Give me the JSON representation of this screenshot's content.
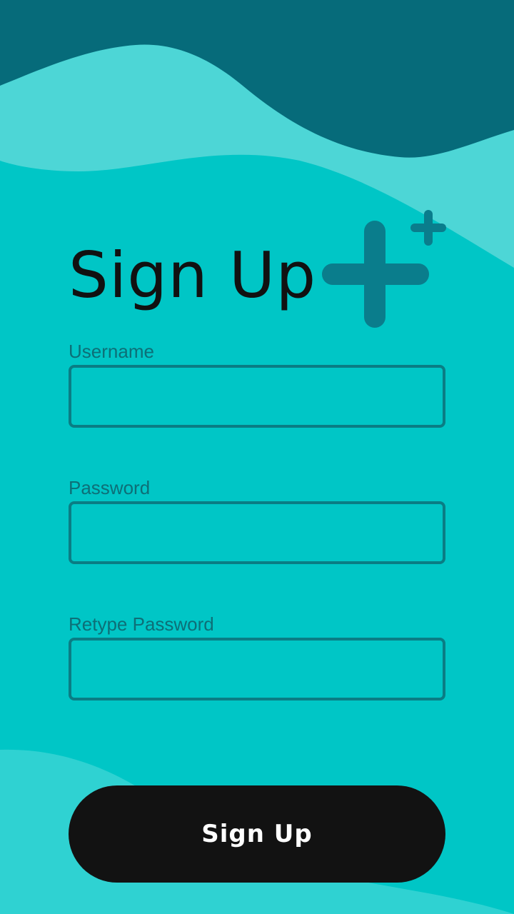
{
  "theme": {
    "background": "#00c6c6",
    "wave_dark": "#066b7a",
    "wave_light": "#4dd6d6",
    "field_border": "#0a7d84",
    "label_color": "#0d6f77",
    "icon_color": "#0a7d8c",
    "button_background": "#121212",
    "button_text_color": "#ffffff"
  },
  "header": {
    "title": "Sign Up",
    "icon": "add-user-plus-icon"
  },
  "form": {
    "fields": [
      {
        "label": "Username",
        "value": "",
        "placeholder": ""
      },
      {
        "label": "Password",
        "value": "",
        "placeholder": ""
      },
      {
        "label": "Retype Password",
        "value": "",
        "placeholder": ""
      }
    ],
    "submit_label": "Sign Up"
  }
}
